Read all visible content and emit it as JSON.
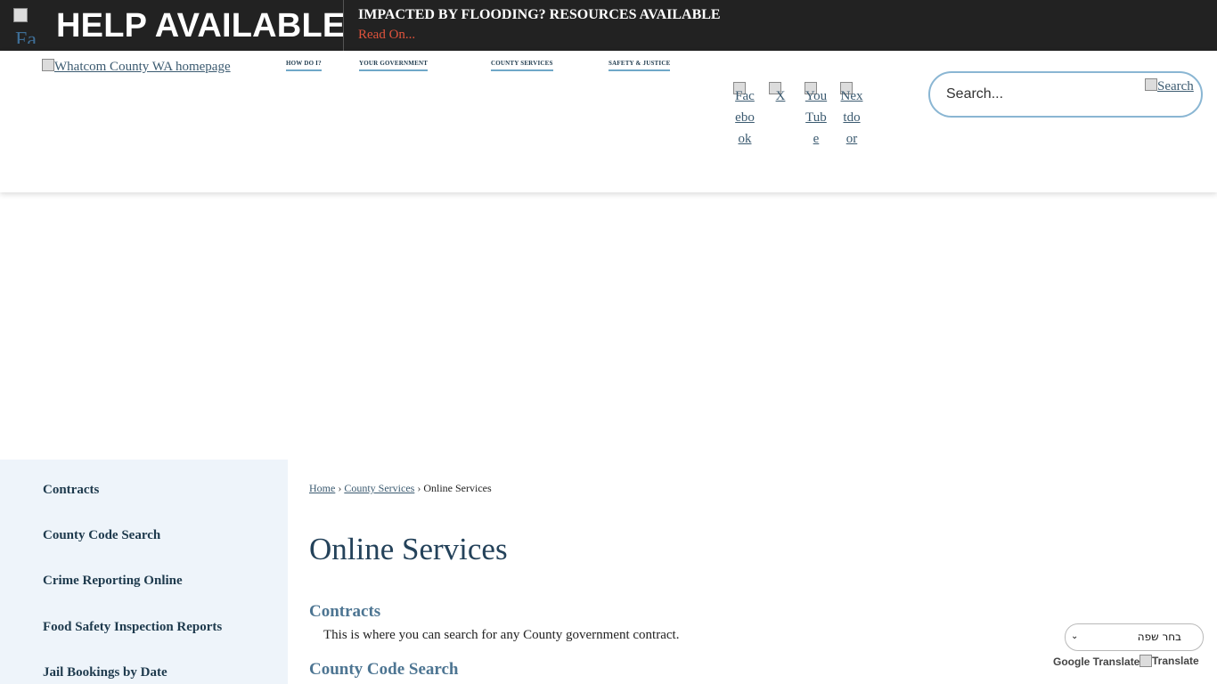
{
  "alert": {
    "image_alt": "Fa",
    "title": "HELP AVAILABLE",
    "headline": "IMPACTED BY FLOODING? RESOURCES AVAILABLE",
    "link_text": "Read On..."
  },
  "header": {
    "logo_alt": "Whatcom County WA homepage",
    "nav": [
      "HOW DO I?",
      "YOUR GOVERNMENT",
      "COUNTY SERVICES",
      "SAFETY & JUSTICE"
    ],
    "social": [
      "Facebook",
      "X",
      "YouTube",
      "Nextdoor"
    ],
    "search": {
      "placeholder": "Search...",
      "button_alt": "Search"
    }
  },
  "sidebar": {
    "items": [
      "Contracts",
      "County Code Search",
      "Crime Reporting Online",
      "Food Safety Inspection Reports",
      "Jail Bookings by Date"
    ]
  },
  "breadcrumb": {
    "items": [
      "Home",
      "County Services"
    ],
    "current": "Online Services",
    "separator": "›"
  },
  "main": {
    "title": "Online Services",
    "sections": [
      {
        "title": "Contracts",
        "description": "This is where you can search for any County government contract."
      },
      {
        "title": "County Code Search",
        "description": ""
      }
    ]
  },
  "translate": {
    "select_label": "בחר שפה",
    "powered_by": "Google Translate",
    "button_alt": "Translate"
  },
  "colors": {
    "alert_bg": "#222222",
    "alert_link": "#e0533c",
    "sidebar_bg": "#eef4fa",
    "title": "#24425a",
    "section_title": "#4d7592",
    "link": "#3b5a70",
    "search_border": "#8ab6d3"
  }
}
